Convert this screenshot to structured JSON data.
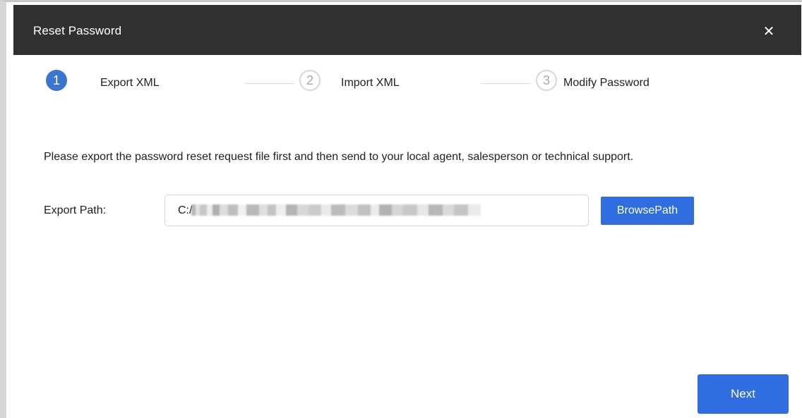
{
  "dialog": {
    "title": "Reset Password",
    "close_glyph": "✕"
  },
  "steps": [
    {
      "number": "1",
      "label": "Export XML",
      "state": "active"
    },
    {
      "number": "2",
      "label": "Import XML",
      "state": "inactive"
    },
    {
      "number": "3",
      "label": "Modify Password",
      "state": "inactive"
    }
  ],
  "instruction": "Please export the password reset request file first and then send to your local agent, salesperson or technical support.",
  "export_path": {
    "label": "Export Path:",
    "value": "C:/"
  },
  "buttons": {
    "browse": "BrowsePath",
    "next": "Next"
  },
  "colors": {
    "title_bar": "#303030",
    "accent": "#2f6de0",
    "active_step": "#3a76d0"
  }
}
